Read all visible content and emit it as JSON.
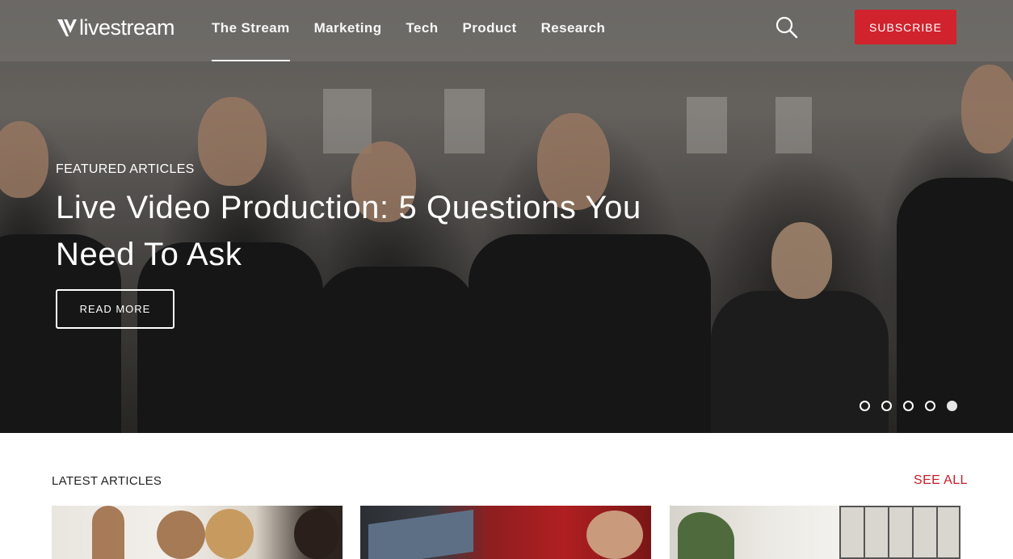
{
  "brand": {
    "logo_text": "livestream"
  },
  "nav": {
    "items": [
      {
        "label": "The Stream",
        "active": true
      },
      {
        "label": "Marketing",
        "active": false
      },
      {
        "label": "Tech",
        "active": false
      },
      {
        "label": "Product",
        "active": false
      },
      {
        "label": "Research",
        "active": false
      }
    ],
    "search_icon": "search-icon",
    "subscribe_label": "SUBSCRIBE"
  },
  "hero": {
    "kicker": "FEATURED ARTICLES",
    "title": "Live Video Production: 5 Questions You Need To Ask",
    "cta_label": "READ MORE",
    "slides_total": 5,
    "active_slide": 5
  },
  "latest": {
    "heading": "LATEST ARTICLES",
    "see_all_label": "SEE ALL"
  },
  "colors": {
    "accent": "#d0232e",
    "link_red": "#c41e28",
    "text_dark": "#222222",
    "white": "#ffffff"
  }
}
